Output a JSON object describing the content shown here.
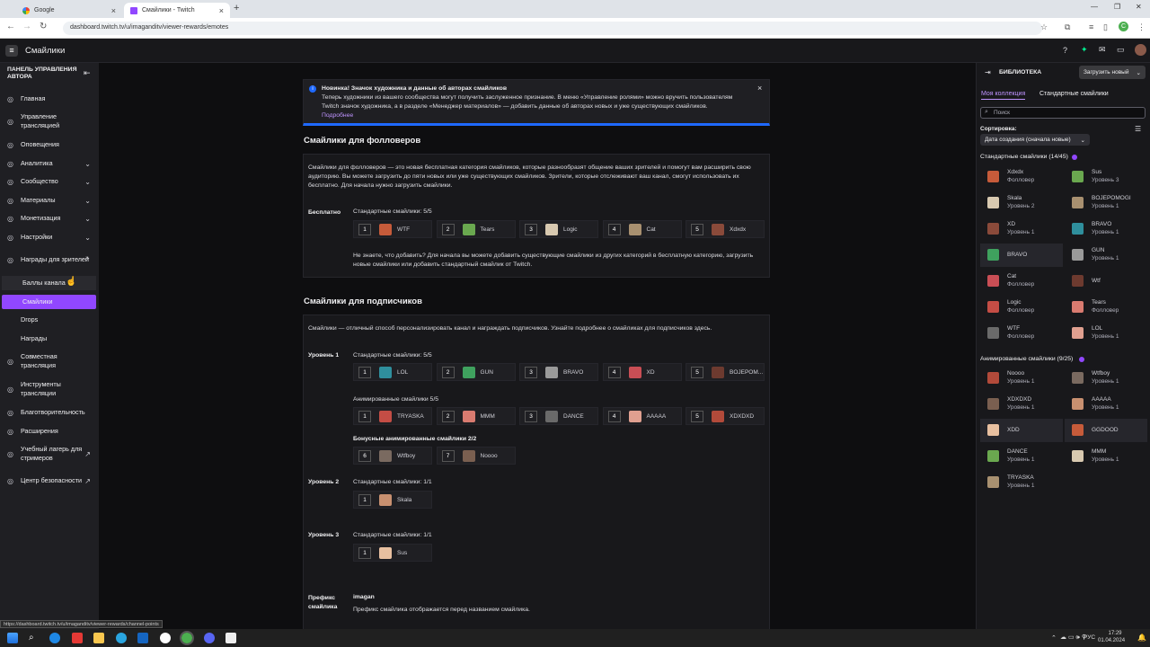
{
  "browser": {
    "tabs": [
      {
        "title": "Google",
        "active": false
      },
      {
        "title": "Смайлики - Twitch",
        "active": true
      }
    ],
    "url": "dashboard.twitch.tv/u/imaganditv/viewer-rewards/emotes",
    "status_url": "https://dashboard.twitch.tv/u/imaganditv/viewer-rewards/channel-points"
  },
  "topbar": {
    "title": "Смайлики"
  },
  "sidebar": {
    "header": "ПАНЕЛЬ УПРАВЛЕНИЯ АВТОРА",
    "items": [
      {
        "label": "Главная",
        "icon": "home-icon",
        "chevron": ""
      },
      {
        "label": "Управление трансляцией",
        "icon": "broadcast-icon",
        "chevron": ""
      },
      {
        "label": "Оповещения",
        "icon": "alert-icon",
        "chevron": ""
      },
      {
        "label": "Аналитика",
        "icon": "analytics-icon",
        "chevron": "⌄"
      },
      {
        "label": "Сообщество",
        "icon": "community-icon",
        "chevron": "⌄"
      },
      {
        "label": "Материалы",
        "icon": "content-icon",
        "chevron": "⌄"
      },
      {
        "label": "Монетизация",
        "icon": "monetization-icon",
        "chevron": "⌄"
      },
      {
        "label": "Настройки",
        "icon": "settings-icon",
        "chevron": "⌄"
      },
      {
        "label": "Награды для зрителей",
        "icon": "rewards-icon",
        "chevron": "⌃"
      },
      {
        "label": "Баллы канала",
        "icon": "",
        "chevron": ""
      },
      {
        "label": "Смайлики",
        "icon": "",
        "chevron": ""
      },
      {
        "label": "Drops",
        "icon": "",
        "chevron": ""
      },
      {
        "label": "Награды",
        "icon": "",
        "chevron": ""
      },
      {
        "label": "Совместная трансляция",
        "icon": "collab-icon",
        "chevron": ""
      },
      {
        "label": "Инструменты трансляции",
        "icon": "tools-icon",
        "chevron": ""
      },
      {
        "label": "Благотворительность",
        "icon": "charity-icon",
        "chevron": ""
      },
      {
        "label": "Расширения",
        "icon": "extensions-icon",
        "chevron": ""
      },
      {
        "label": "Учебный лагерь для стримеров",
        "icon": "bootcamp-icon",
        "chevron": "↗"
      },
      {
        "label": "Центр безопасности",
        "icon": "safety-icon",
        "chevron": "↗"
      }
    ]
  },
  "banner": {
    "title": "Новинка! Значок художника и данные об авторах смайликов",
    "body1": "Теперь художники из вашего сообщества могут получить заслуженное признание. В меню «Управление ролями» можно вручить пользователям",
    "body2": "Twitch значок художника, а в разделе «Менеджер материалов» — добавить данные об авторах новых и уже существующих смайликов.",
    "more": "Подробнее"
  },
  "followers": {
    "title": "Смайлики для фолловеров",
    "desc1": "Смайлики для фолловеров — это новая бесплатная категория смайликов, которые разнообразят общение ваших зрителей и помогут вам расширить свою",
    "desc2": "аудиторию. Вы можете загрузить до пяти новых или уже существующих смайликов. Зрители, которые отслеживают ваш канал, смогут использовать их",
    "desc3": "бесплатно. Для начала нужно загрузить смайлики.",
    "free": "Бесплатно",
    "std": "Стандартные смайлики: 5/5",
    "slots": [
      {
        "n": "1",
        "name": "WTF"
      },
      {
        "n": "2",
        "name": "Tears"
      },
      {
        "n": "3",
        "name": "Logic"
      },
      {
        "n": "4",
        "name": "Cat"
      },
      {
        "n": "5",
        "name": "Xdxdx"
      }
    ],
    "hint1": "Не знаете, что добавить? Для начала вы можете добавить существующие смайлики из других категорий в бесплатную категорию, загрузить",
    "hint2": "новые смайлики или добавить стандартный смайлик от Twitch."
  },
  "subs": {
    "title": "Смайлики для подписчиков",
    "desc": "Смайлики — отличный способ персонализировать канал и награждать подписчиков. Узнайте подробнее о смайликах для подписчиков здесь.",
    "t1": "Уровень 1",
    "t1std": "Стандартные смайлики: 5/5",
    "t1slots": [
      {
        "n": "1",
        "name": "LOL"
      },
      {
        "n": "2",
        "name": "GUN"
      },
      {
        "n": "3",
        "name": "BRAVO"
      },
      {
        "n": "4",
        "name": "XD"
      },
      {
        "n": "5",
        "name": "BOJEPOM..."
      }
    ],
    "t1anim": "Анимированные смайлики 5/5",
    "t1aslots": [
      {
        "n": "1",
        "name": "TRYASKA"
      },
      {
        "n": "2",
        "name": "MMM"
      },
      {
        "n": "3",
        "name": "DANCE"
      },
      {
        "n": "4",
        "name": "AAAAA"
      },
      {
        "n": "5",
        "name": "XDXDXD"
      }
    ],
    "t1bonus": "Бонусные анимированные смайлики 2/2",
    "t1bslots": [
      {
        "n": "6",
        "name": "Wtfboy"
      },
      {
        "n": "7",
        "name": "Noooo"
      }
    ],
    "t2": "Уровень 2",
    "t2std": "Стандартные смайлики: 1/1",
    "t2slots": [
      {
        "n": "1",
        "name": "Skala"
      }
    ],
    "t3": "Уровень 3",
    "t3std": "Стандартные смайлики: 1/1",
    "t3slots": [
      {
        "n": "1",
        "name": "Sus"
      }
    ],
    "prefix": "Префикс смайлика",
    "prefix_val": "imagan",
    "prefix_hint": "Префикс смайлика отображается перед названием смайлика."
  },
  "library": {
    "title": "БИБЛИОТЕКА",
    "upload": "Загрузить новый",
    "tab1": "Моя коллекция",
    "tab2": "Стандартные смайлики",
    "search": "Поиск",
    "sort_label": "Сортировка:",
    "sort_value": "Дата создания (сначала новые)",
    "std_header": "Стандартные смайлики (14/45)",
    "std": [
      {
        "name": "Xdxdx",
        "tier": "Фолловер"
      },
      {
        "name": "Sus",
        "tier": "Уровень 3"
      },
      {
        "name": "Skala",
        "tier": "Уровень 2"
      },
      {
        "name": "BOJEPOMOGI",
        "tier": "Уровень 1"
      },
      {
        "name": "XD",
        "tier": "Уровень 1"
      },
      {
        "name": "BRAVO",
        "tier": "Уровень 1"
      },
      {
        "name": "BRAVO",
        "tier": ""
      },
      {
        "name": "GUN",
        "tier": "Уровень 1"
      },
      {
        "name": "Cat",
        "tier": "Фолловер"
      },
      {
        "name": "Wtf",
        "tier": ""
      },
      {
        "name": "Logic",
        "tier": "Фолловер"
      },
      {
        "name": "Tears",
        "tier": "Фолловер"
      },
      {
        "name": "WTF",
        "tier": "Фолловер"
      },
      {
        "name": "LOL",
        "tier": "Уровень 1"
      }
    ],
    "anim_header": "Анимированные смайлики (9/25)",
    "anim": [
      {
        "name": "Noooo",
        "tier": "Уровень 1"
      },
      {
        "name": "Wtfboy",
        "tier": "Уровень 1"
      },
      {
        "name": "XDXDXD",
        "tier": "Уровень 1"
      },
      {
        "name": "AAAAA",
        "tier": "Уровень 1"
      },
      {
        "name": "XDD",
        "tier": ""
      },
      {
        "name": "GGDOOD",
        "tier": ""
      },
      {
        "name": "DANCE",
        "tier": "Уровень 1"
      },
      {
        "name": "MMM",
        "tier": "Уровень 1"
      },
      {
        "name": "TRYASKA",
        "tier": "Уровень 1"
      }
    ]
  },
  "taskbar": {
    "lang": "РУС",
    "time": "17:29",
    "date": "01.04.2024"
  },
  "colors": {
    "accent": "#9147ff",
    "link": "#bf94ff",
    "banner_bar": "#1f69ff"
  }
}
